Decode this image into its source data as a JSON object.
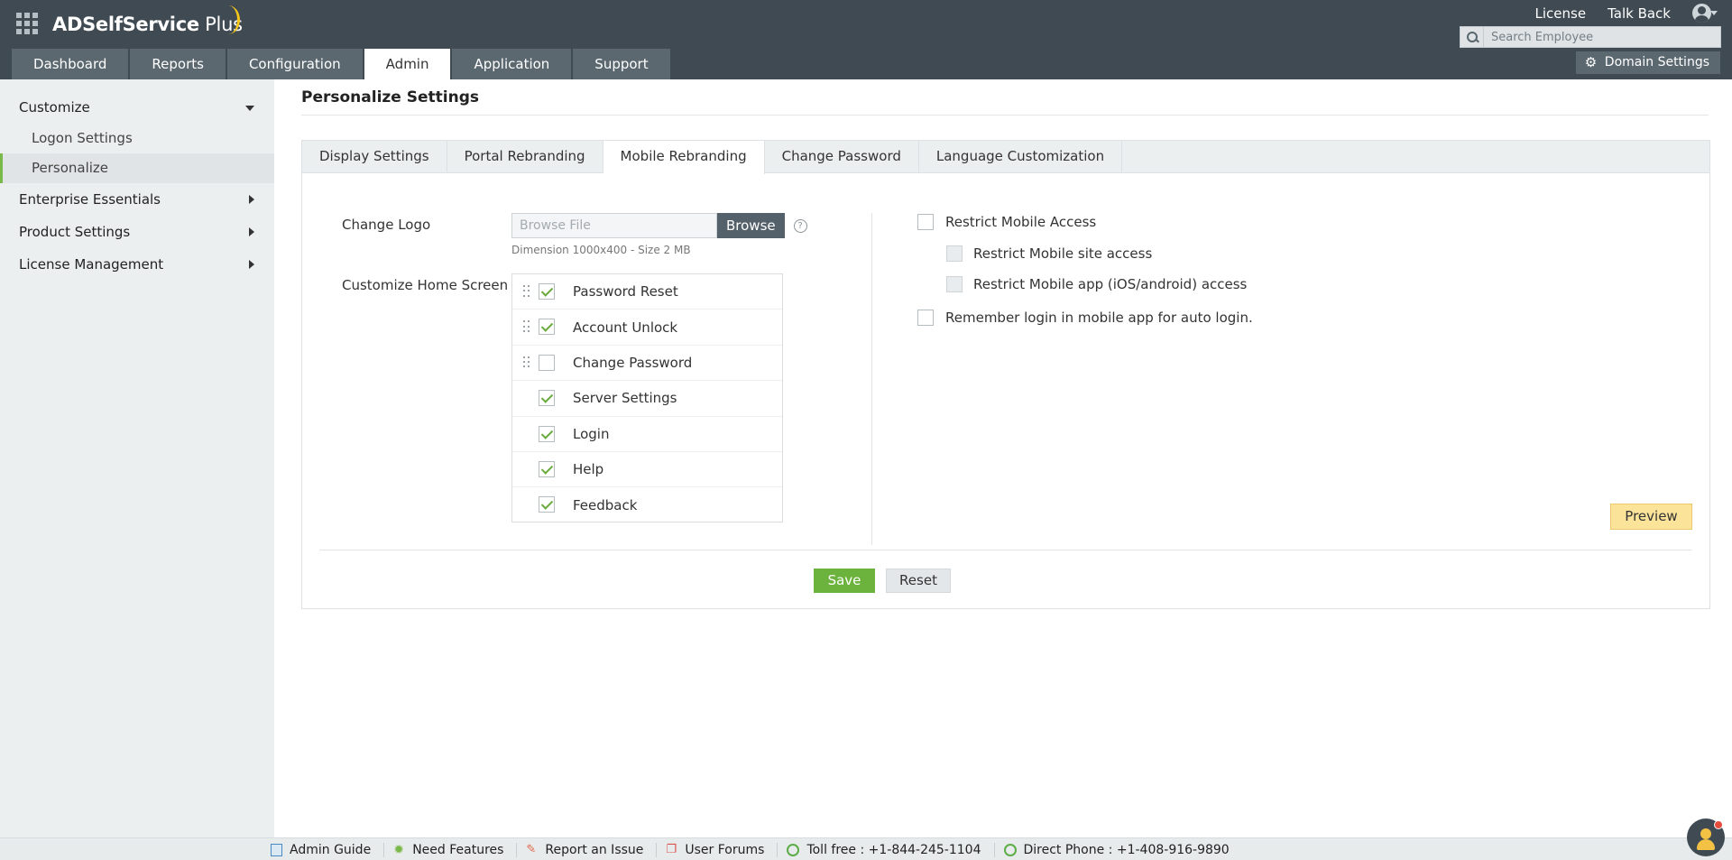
{
  "header": {
    "logo_main": "ADSelfService",
    "logo_plus": " Plus",
    "top_links": [
      "License",
      "Talk Back"
    ],
    "search_placeholder": "Search Employee",
    "nav_tabs": [
      "Dashboard",
      "Reports",
      "Configuration",
      "Admin",
      "Application",
      "Support"
    ],
    "active_tab": "Admin",
    "domain_settings_label": "Domain Settings"
  },
  "sidebar": {
    "customize": "Customize",
    "customize_items": [
      "Logon Settings",
      "Personalize"
    ],
    "active_item": "Personalize",
    "other_sections": [
      "Enterprise Essentials",
      "Product Settings",
      "License Management"
    ]
  },
  "main": {
    "page_title": "Personalize Settings",
    "sub_tabs": [
      "Display Settings",
      "Portal Rebranding",
      "Mobile Rebranding",
      "Change Password",
      "Language Customization"
    ],
    "active_sub_tab": "Mobile Rebranding",
    "change_logo_label": "Change Logo",
    "browse_placeholder": "Browse File",
    "browse_button": "Browse",
    "help_icon": "?",
    "dimension_text": "Dimension 1000x400 - Size 2 MB",
    "customize_home_label": "Customize Home Screen",
    "home_items": [
      {
        "label": "Password Reset",
        "checked": true,
        "draggable": true
      },
      {
        "label": "Account Unlock",
        "checked": true,
        "draggable": true
      },
      {
        "label": "Change Password",
        "checked": false,
        "draggable": true
      },
      {
        "label": "Server Settings",
        "checked": true,
        "draggable": false
      },
      {
        "label": "Login",
        "checked": true,
        "draggable": false
      },
      {
        "label": "Help",
        "checked": true,
        "draggable": false
      },
      {
        "label": "Feedback",
        "checked": true,
        "draggable": false
      }
    ],
    "restrict_mobile_access": "Restrict Mobile Access",
    "restrict_site": "Restrict Mobile site access",
    "restrict_app": "Restrict Mobile app (iOS/android) access",
    "remember_login": "Remember login in mobile app for auto login.",
    "preview_button": "Preview",
    "save_button": "Save",
    "reset_button": "Reset"
  },
  "footer": {
    "links": [
      "Admin Guide",
      "Need Features",
      "Report an Issue",
      "User Forums",
      "Toll free : +1-844-245-1104",
      "Direct Phone : +1-408-916-9890"
    ]
  },
  "colors": {
    "header_bg": "#3f4a52",
    "nav_tab_bg": "#5b6870",
    "accent_green": "#6cb33e",
    "preview_yellow": "#fbe39a"
  }
}
